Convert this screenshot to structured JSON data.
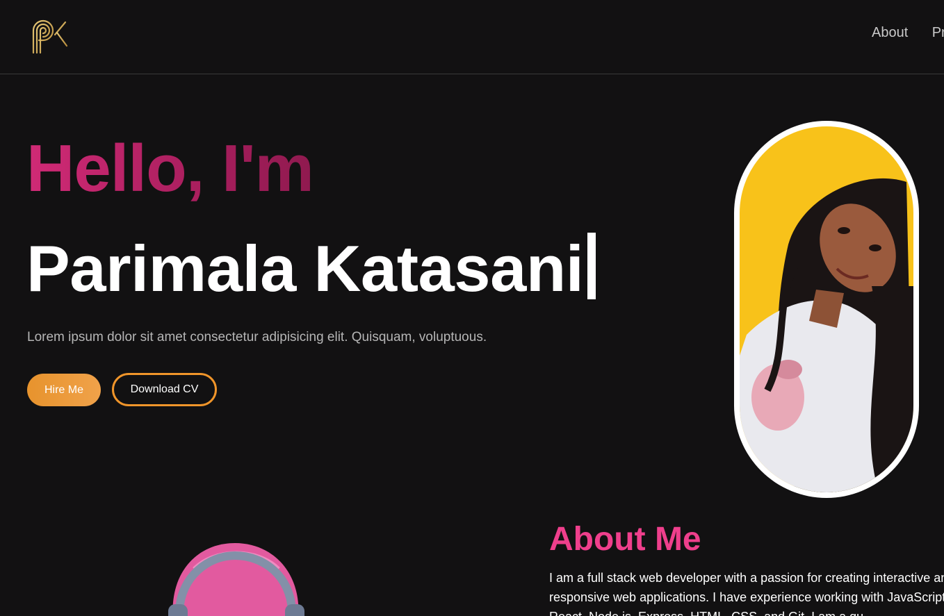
{
  "header": {
    "logo_text": "pk",
    "nav": [
      "About",
      "Pr"
    ]
  },
  "hero": {
    "greeting": "Hello, I'm",
    "name": "Parimala Katasani",
    "intro": "Lorem ipsum dolor sit amet consectetur adipisicing elit. Quisquam, voluptuous.",
    "hire_label": "Hire Me",
    "cv_label": "Download CV"
  },
  "about": {
    "title": "About Me",
    "text": "I am a full stack web developer with a passion for creating interactive and responsive web applications. I have experience working with JavaScript, React, Node.js, Express, HTML, CSS, and Git. I am a qu"
  },
  "colors": {
    "background": "#121112",
    "greeting_gradient": [
      "#d02a76",
      "#8f1a4f"
    ],
    "accent_orange": "#f0952a",
    "about_title": "#ef3f8c",
    "portrait_bg": "#f8c21a"
  },
  "icons": [
    "logo-monogram-icon",
    "typing-cursor-icon",
    "portrait-photo",
    "avatar-3d-illustration"
  ]
}
